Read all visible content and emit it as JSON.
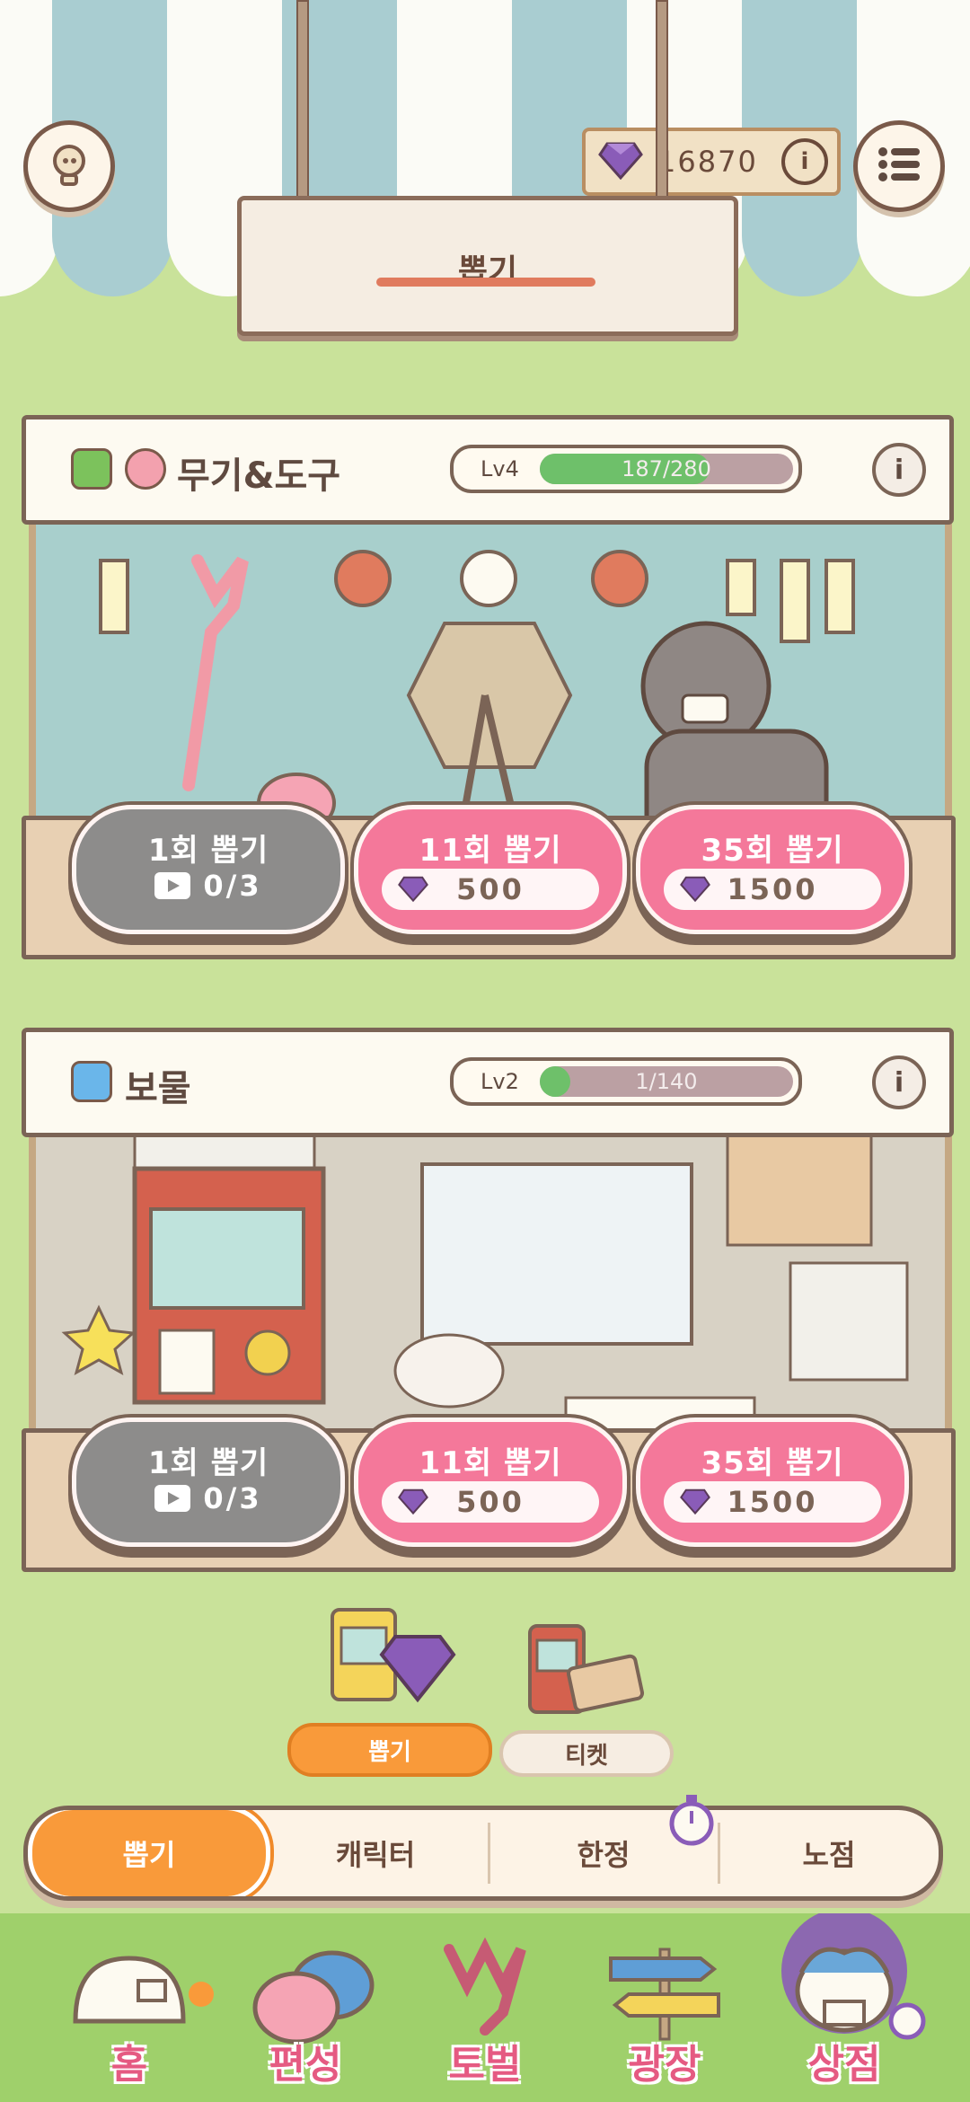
{
  "header": {
    "hint_button_icon": "lightbulb-icon",
    "currency_value": "16870",
    "menu_icon": "menu-list-icon",
    "sign_title": "뽑기"
  },
  "stalls": [
    {
      "name": "무기&도구",
      "level": "Lv4",
      "progress_text": "187/280",
      "progress": 0.67,
      "badge_colors": [
        "#7cc25c",
        "#f3a1ae"
      ],
      "buttons": [
        {
          "label": "1회 뽑기",
          "type": "ad",
          "value": "0/3"
        },
        {
          "label": "11회 뽑기",
          "type": "gem",
          "value": "500"
        },
        {
          "label": "35회 뽑기",
          "type": "gem",
          "value": "1500"
        }
      ]
    },
    {
      "name": "보물",
      "level": "Lv2",
      "progress_text": "1/140",
      "progress": 0.01,
      "badge_colors": [
        "#6ab6ea"
      ],
      "buttons": [
        {
          "label": "1회 뽑기",
          "type": "ad",
          "value": "0/3"
        },
        {
          "label": "11회 뽑기",
          "type": "gem",
          "value": "500"
        },
        {
          "label": "35회 뽑기",
          "type": "gem",
          "value": "1500"
        }
      ]
    }
  ],
  "subtabs": [
    {
      "label": "뽑기",
      "active": true
    },
    {
      "label": "티켓",
      "active": false
    }
  ],
  "categories": [
    "뽑기",
    "캐릭터",
    "한정",
    "노점"
  ],
  "nav": [
    "홈",
    "편성",
    "토벌",
    "광장",
    "상점"
  ],
  "colors": {
    "pink_button": "#f4789a",
    "grey_button": "#8d8c8b",
    "accent_orange": "#f99a3a",
    "nav_pink": "#e55a82"
  }
}
